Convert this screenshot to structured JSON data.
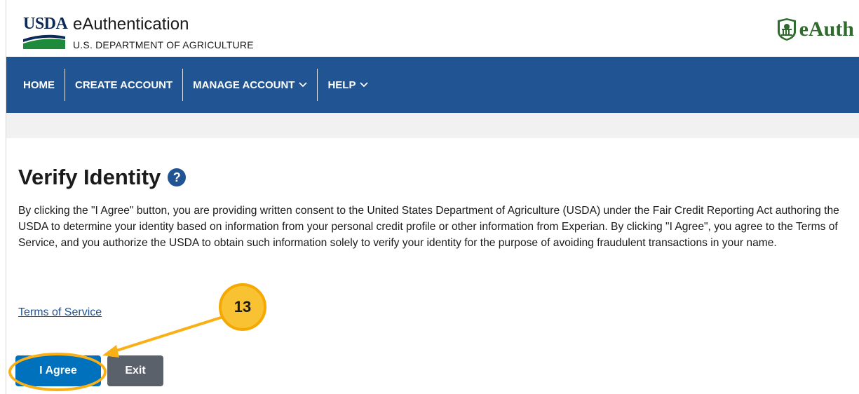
{
  "header": {
    "logo_text": "USDA",
    "title": "eAuthentication",
    "subtitle": "U.S. DEPARTMENT OF AGRICULTURE",
    "brand_text": "eAuth",
    "brand_icon": "capitol-building-icon"
  },
  "nav": {
    "items": [
      {
        "label": "HOME",
        "has_dropdown": false
      },
      {
        "label": "CREATE ACCOUNT",
        "has_dropdown": false
      },
      {
        "label": "MANAGE ACCOUNT",
        "has_dropdown": true
      },
      {
        "label": "HELP",
        "has_dropdown": true
      }
    ]
  },
  "main": {
    "title": "Verify Identity",
    "help_icon": "question-mark-icon",
    "consent_text": "By clicking the \"I Agree\" button, you are providing written consent to the United States Department of Agriculture (USDA) under the Fair Credit Reporting Act authoring the USDA to determine your identity based on information from your personal credit profile or other information from Experian. By clicking \"I Agree\", you agree to the Terms of Service, and you authorize the USDA to obtain such information solely to verify your identity for the purpose of avoiding fraudulent transactions in your name.",
    "terms_link": "Terms of Service",
    "agree_button": "I Agree",
    "exit_button": "Exit"
  },
  "callout": {
    "number": "13"
  },
  "colors": {
    "nav_bg": "#205493",
    "primary_button": "#0071bc",
    "secondary_button": "#5b616b",
    "callout": "#f9b016",
    "brand_green": "#2e6b2d"
  }
}
